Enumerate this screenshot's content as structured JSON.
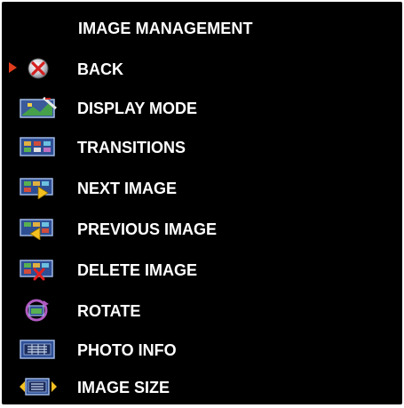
{
  "menu": {
    "title": "IMAGE MANAGEMENT",
    "items": [
      {
        "label": "BACK",
        "icon": "back-x-icon",
        "selected": true
      },
      {
        "label": "DISPLAY MODE",
        "icon": "display-mode-icon"
      },
      {
        "label": "TRANSITIONS",
        "icon": "transitions-icon"
      },
      {
        "label": "NEXT IMAGE",
        "icon": "next-image-icon"
      },
      {
        "label": "PREVIOUS IMAGE",
        "icon": "previous-image-icon"
      },
      {
        "label": "DELETE IMAGE",
        "icon": "delete-image-icon"
      },
      {
        "label": "ROTATE",
        "icon": "rotate-icon"
      },
      {
        "label": "PHOTO INFO",
        "icon": "photo-info-icon"
      },
      {
        "label": "IMAGE SIZE",
        "icon": "image-size-icon"
      }
    ]
  },
  "colors": {
    "background": "#000000",
    "text": "#ffffff",
    "selection_arrow": "#e03c1c"
  }
}
